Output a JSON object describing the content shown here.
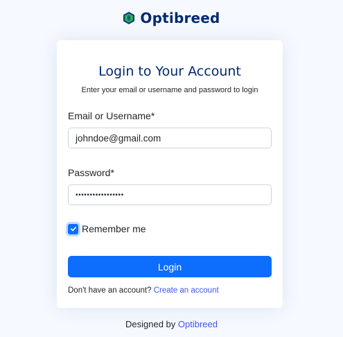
{
  "brand": {
    "name": "Optibreed",
    "logo_colors": {
      "leaf": "#2eb84c",
      "outline": "#0a3a8c"
    }
  },
  "login": {
    "title": "Login to Your Account",
    "subtitle": "Enter your email or username and password to login",
    "username_label": "Email or Username*",
    "username_value": "johndoe@gmail.com",
    "password_label": "Password*",
    "password_masked": "•••••••••••••••••",
    "remember_label": "Remember me",
    "remember_checked": true,
    "submit_label": "Login",
    "signup_prompt": "Don't have an account?",
    "signup_link": "Create an account"
  },
  "footer": {
    "designed_by": "Designed by",
    "designer_link": "Optibreed"
  },
  "colors": {
    "primary": "#0d6efd",
    "title": "#012970",
    "link": "#4154f1",
    "background": "#f6f9ff"
  }
}
